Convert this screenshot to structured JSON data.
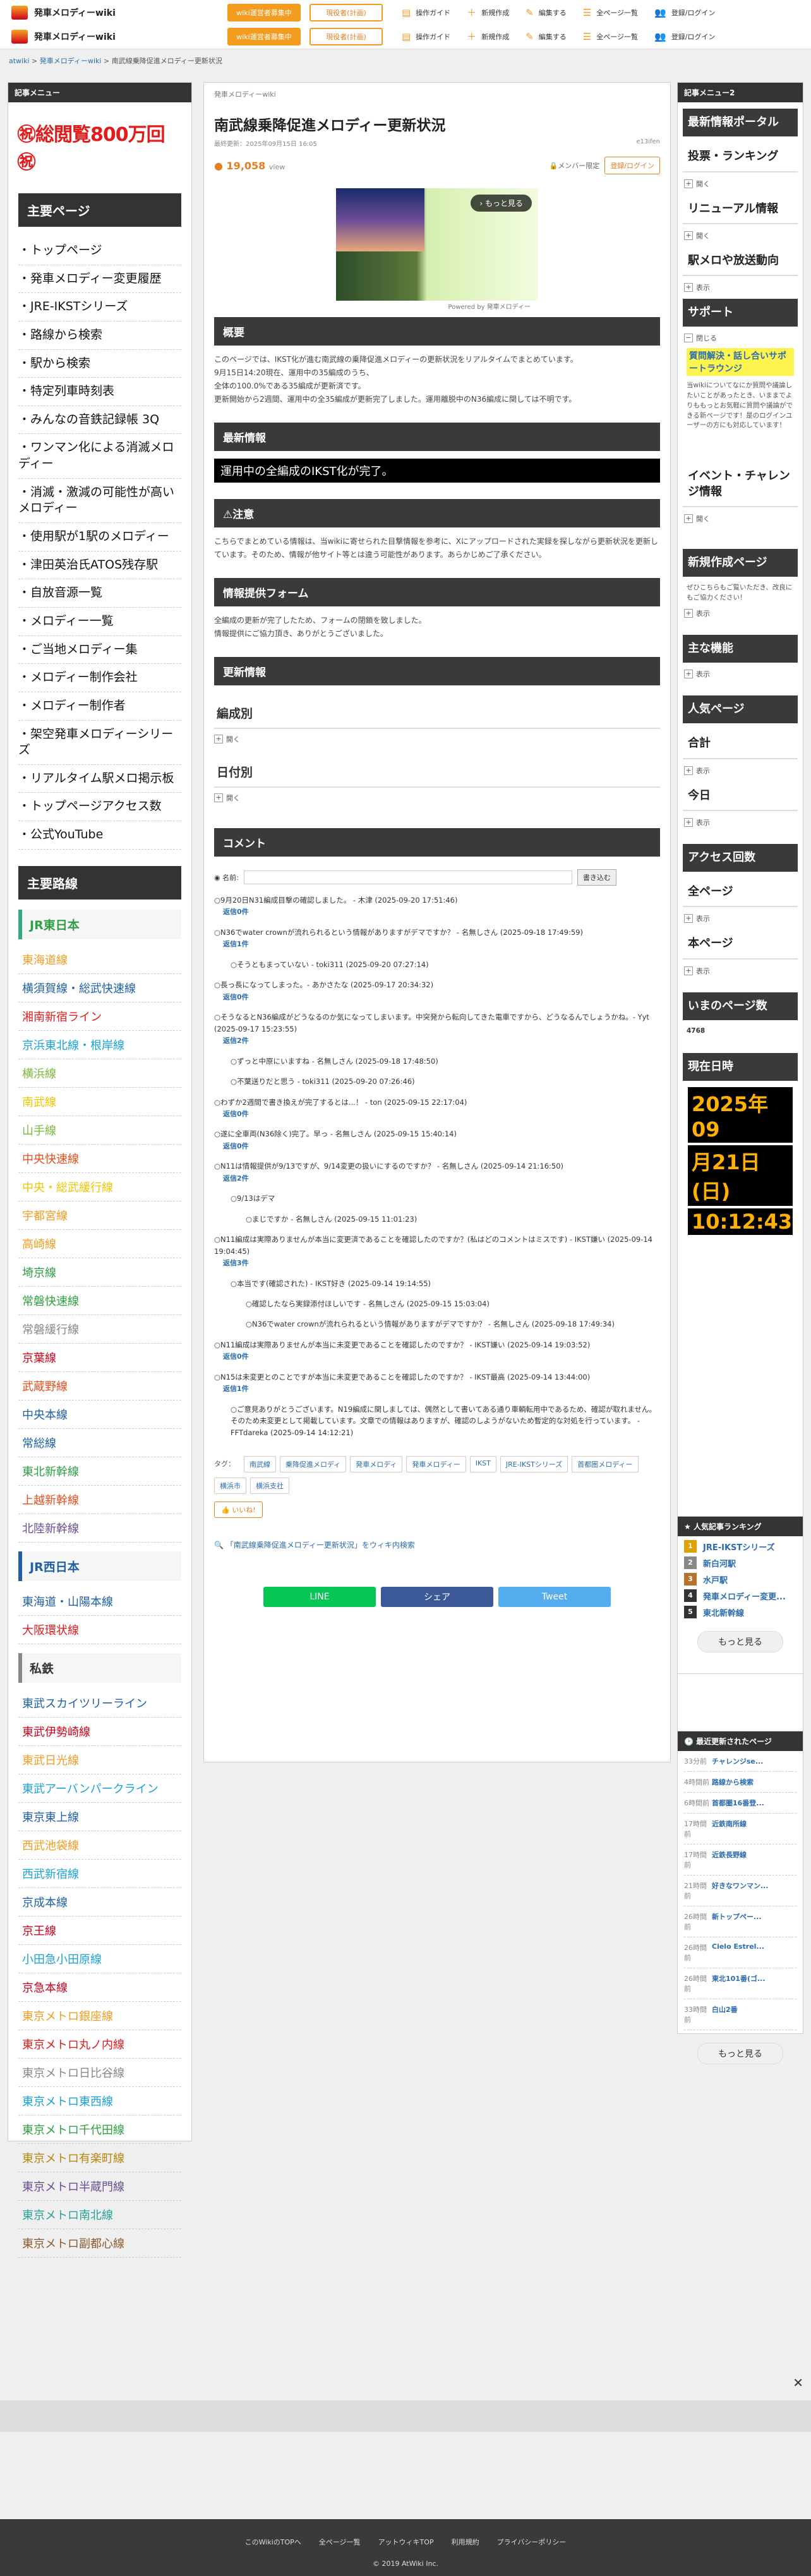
{
  "header": {
    "site_name": "発車メロディーwiki",
    "btn_recruit": "wiki運営者募集中",
    "btn_monitor": "現役者(計画)",
    "menu": [
      "操作ガイド",
      "新規作成",
      "編集する",
      "全ページ一覧",
      "登録/ログイン"
    ]
  },
  "breadcrumb": [
    "atwiki",
    "発車メロディーwiki",
    "南武線乗降促進メロディー更新状況"
  ],
  "left": {
    "menu_title": "記事メニュー",
    "counter": "㊗総閲覧800万回㊗",
    "main_pages_title": "主要ページ",
    "main_pages": [
      "トップページ",
      "発車メロディー変更履歴",
      "JRE-IKSTシリーズ",
      "路線から検索",
      "駅から検索",
      "特定列車時刻表",
      "みんなの音鉄記録帳 3Q",
      "ワンマン化による消滅メロディー",
      "消滅・激減の可能性が高いメロディー",
      "使用駅が1駅のメロディー",
      "津田英治氏ATOS残存駅",
      "自放音源一覧",
      "メロディー一覧",
      "ご当地メロディー集",
      "メロディー制作会社",
      "メロディー制作者",
      "架空発車メロディーシリーズ",
      "リアルタイム駅メロ掲示板",
      "トップページアクセス数",
      "公式YouTube"
    ],
    "routes_title": "主要路線",
    "jre_title": "JR東日本",
    "jre": [
      {
        "n": "東海道線",
        "c": "#f39c1f"
      },
      {
        "n": "横須賀線・総武快速線",
        "c": "#1f5fa8"
      },
      {
        "n": "湘南新宿ライン",
        "c": "#e31b1b"
      },
      {
        "n": "京浜東北線・根岸線",
        "c": "#1aa3d8"
      },
      {
        "n": "横浜線",
        "c": "#7cb83b"
      },
      {
        "n": "南武線",
        "c": "#f3c400"
      },
      {
        "n": "山手線",
        "c": "#7cb83b"
      },
      {
        "n": "中央快速線",
        "c": "#e84e1b"
      },
      {
        "n": "中央・総武緩行線",
        "c": "#f3c400"
      },
      {
        "n": "宇都宮線",
        "c": "#f39c1f"
      },
      {
        "n": "高崎線",
        "c": "#f39c1f"
      },
      {
        "n": "埼京線",
        "c": "#2ea043"
      },
      {
        "n": "常磐快速線",
        "c": "#2ea043"
      },
      {
        "n": "常磐緩行線",
        "c": "#888888"
      },
      {
        "n": "京葉線",
        "c": "#d0021b"
      },
      {
        "n": "武蔵野線",
        "c": "#e84e1b"
      },
      {
        "n": "中央本線",
        "c": "#1f5fa8"
      },
      {
        "n": "常総線",
        "c": "#1f5fa8"
      },
      {
        "n": "東北新幹線",
        "c": "#2ea043"
      },
      {
        "n": "上越新幹線",
        "c": "#e84e1b"
      },
      {
        "n": "北陸新幹線",
        "c": "#6a4c93"
      }
    ],
    "jrw_title": "JR西日本",
    "jrw": [
      {
        "n": "東海道・山陽本線",
        "c": "#1f5fa8"
      },
      {
        "n": "大阪環状線",
        "c": "#e31b1b"
      }
    ],
    "private_title": "私鉄",
    "private": [
      {
        "n": "東武スカイツリーライン",
        "c": "#1f5fa8"
      },
      {
        "n": "東武伊勢崎線",
        "c": "#d0021b"
      },
      {
        "n": "東武日光線",
        "c": "#f39c1f"
      },
      {
        "n": "東武アーバンパークライン",
        "c": "#1aa3d8"
      },
      {
        "n": "東京東上線",
        "c": "#1f5fa8"
      },
      {
        "n": "西武池袋線",
        "c": "#f39c1f"
      },
      {
        "n": "西武新宿線",
        "c": "#1aa3d8"
      },
      {
        "n": "京成本線",
        "c": "#1f5fa8"
      },
      {
        "n": "京王線",
        "c": "#d0021b"
      },
      {
        "n": "小田急小田原線",
        "c": "#1aa3d8"
      },
      {
        "n": "京急本線",
        "c": "#d0021b"
      },
      {
        "n": "東京メトロ銀座線",
        "c": "#f39c1f"
      },
      {
        "n": "東京メトロ丸ノ内線",
        "c": "#e31b1b"
      },
      {
        "n": "東京メトロ日比谷線",
        "c": "#888888"
      },
      {
        "n": "東京メトロ東西線",
        "c": "#1aa3d8"
      },
      {
        "n": "東京メトロ千代田線",
        "c": "#2ea043"
      },
      {
        "n": "東京メトロ有楽町線",
        "c": "#b8860b"
      },
      {
        "n": "東京メトロ半蔵門線",
        "c": "#6a4c93"
      },
      {
        "n": "東京メトロ南北線",
        "c": "#2aa198"
      },
      {
        "n": "東京メトロ副都心線",
        "c": "#8b5a2b"
      }
    ]
  },
  "main": {
    "site": "発車メロディーwiki",
    "title": "南武線乗降促進メロディー更新状況",
    "updated": "最終更新：2025年09月15日 16:05",
    "author": "e13ifen",
    "views": "19,058",
    "views_unit": "view",
    "member": "メンバー限定",
    "login": "登録/ログイン",
    "more_btn": "もっと見る",
    "thumb_cap": "Powered by 発車メロディー",
    "h_overview": "概要",
    "overview": [
      "このページでは、IKST化が進む南武線の乗降促進メロディーの更新状況をリアルタイムでまとめています。",
      "9月15日14:20現在、運用中の35編成のうち、",
      "全体の100.0%である35編成が更新済です。",
      "更新開始から2週間、運用中の全35編成が更新完了しました。運用離脱中のN36編成に関しては不明です。"
    ],
    "h_latest": "最新情報",
    "latest": "運用中の全編成のIKST化が完了。",
    "h_note": "⚠注意",
    "note": "こちらでまとめている情報は、当wikiに寄せられた目撃情報を参考に、Xにアップロードされた実録を探しながら更新状況を更新しています。そのため、情報が他サイト等とは違う可能性があります。あらかじめご了承ください。",
    "h_form": "情報提供フォーム",
    "form": [
      "全編成の更新が完了したため、フォームの閉鎖を致しました。",
      "情報提供にご協力頂き、ありがとうございました。"
    ],
    "h_upd": "更新情報",
    "f1": "編成別",
    "f2": "日付別",
    "open": "開く",
    "h_comment": "コメント",
    "name_label": "名前:",
    "submit": "書き込む",
    "comments": [
      {
        "t": "9月20日N31編成目撃の確認しました。 - 木津 (2025-09-20 17:51:46)",
        "r": "返信0件",
        "d": 0
      },
      {
        "t": "N36でwater crownが流れられるという情報がありますがデマですか？ - 名無しさん (2025-09-18 17:49:59)",
        "r": "返信1件",
        "d": 0
      },
      {
        "t": "そうともまっていない - toki311 (2025-09-20 07:27:14)",
        "r": "",
        "d": 1
      },
      {
        "t": "長っ長になってしまった。- あかさたな (2025-09-17 20:34:32)",
        "r": "返信0件",
        "d": 0
      },
      {
        "t": "そうなるとN36編成がどうなるのか気になってしまいます。中突発から転向してきた電車ですから、どうなるんでしょうかね。- Yyt (2025-09-17 15:23:55)",
        "r": "返信2件",
        "d": 0
      },
      {
        "t": "ずっと中原にいますね - 名無しさん (2025-09-18 17:48:50)",
        "r": "",
        "d": 1
      },
      {
        "t": "不葉送りだと思う - toki311 (2025-09-20 07:26:46)",
        "r": "",
        "d": 1
      },
      {
        "t": "わずか2週間で書き換えが完了するとは...！ - ton (2025-09-15 22:17:04)",
        "r": "返信0件",
        "d": 0
      },
      {
        "t": "遂に全車両(N36除く)完了。早っ - 名無しさん (2025-09-15 15:40:14)",
        "r": "返信0件",
        "d": 0
      },
      {
        "t": "N11は情報提供が9/13ですが、9/14変更の扱いにするのですか？ - 名無しさん (2025-09-14 21:16:50)",
        "r": "返信2件",
        "d": 0
      },
      {
        "t": "9/13はデマ",
        "r": "",
        "d": 1
      },
      {
        "t": "まじですか - 名無しさん (2025-09-15 11:01:23)",
        "r": "",
        "d": 2
      },
      {
        "t": "N11編成は実際ありませんが本当に変更済であることを確認したのですか？(私はどのコメントはミスです) - IKST嫌い (2025-09-14 19:04:45)",
        "r": "返信3件",
        "d": 0
      },
      {
        "t": "本当です(確認された) - IKST好き (2025-09-14 19:14:55)",
        "r": "",
        "d": 1
      },
      {
        "t": "確認したなら実録添付ほしいです - 名無しさん (2025-09-15 15:03:04)",
        "r": "",
        "d": 2
      },
      {
        "t": "N36でwater crownが流れられるという情報がありますがデマですか？ - 名無しさん (2025-09-18 17:49:34)",
        "r": "",
        "d": 2
      },
      {
        "t": "N11編成は実際ありませんが本当に未変更であることを確認したのですか？ - IKST嫌い (2025-09-14 19:03:52)",
        "r": "返信0件",
        "d": 0
      },
      {
        "t": "N15は未変更とのことですが本当に未変更であることを確認したのですか？ - IKST最高 (2025-09-14 13:44:00)",
        "r": "返信1件",
        "d": 0
      },
      {
        "t": "ご意見ありがとうございます。N19編成に関しましては、偶然として書いてある通り車輌転用中であるため、確認が取れません。そのため未変更として掲載しています。文章での情報はありますが、確認のしようがないため暫定的な対処を行っています。 - FFTdareka (2025-09-14 14:12:21)",
        "r": "",
        "d": 1
      }
    ],
    "tags_label": "タグ：",
    "tags": [
      "南武線",
      "乗降促進メロディ",
      "発車メロディ",
      "発車メロディー",
      "IKST",
      "JRE-IKSTシリーズ",
      "首都圏メロディー",
      "横浜市",
      "横浜支社"
    ],
    "nice": "いいね!",
    "wikiprint": "「南武線乗降促進メロディー更新状況」をウィキ内検索",
    "share": [
      {
        "l": "LINE",
        "c": "#06c755"
      },
      {
        "l": "シェア",
        "c": "#3b5998"
      },
      {
        "l": "Tweet",
        "c": "#55acee"
      }
    ]
  },
  "right": {
    "menu2": "記事メニュー2",
    "p1": "最新情報ポータル",
    "p2": "投票・ランキング",
    "p3": "リニューアル情報",
    "p4": "駅メロや放送動向",
    "show": "表示",
    "open": "開く",
    "close": "閉じる",
    "support": "サポート",
    "support_title": "質問解決・話し合いサポートラウンジ",
    "support_text": "当wikiについてなにか質問や議論したいことがあったとき、いままでよりももっとお気軽に質問や議論ができる新ページです！是のログインユーザーの方にも対応しています！",
    "event": "イベント・チャレンジ情報",
    "newpage": "新規作成ページ",
    "newpage_text": "ぜひこちらもご覧いただき、改良にもご協力ください！",
    "mainfunc": "主な機能",
    "popular": "人気ページ",
    "total": "合計",
    "today": "今日",
    "access": "アクセス回数",
    "allpages": "全ページ",
    "thispage": "本ページ",
    "now_views": "いまのページ数",
    "now_views_val": "4768",
    "time_title": "現在日時",
    "date1": "2025年09",
    "date2": "月21日 (日)",
    "time": "10:12:43",
    "ranking_title": "人気記事ランキング",
    "ranking": [
      {
        "n": "1",
        "t": "JRE-IKSTシリーズ",
        "c": "#e0a000"
      },
      {
        "n": "2",
        "t": "新白河駅",
        "c": "#888"
      },
      {
        "n": "3",
        "t": "水戸駅",
        "c": "#b8732b"
      },
      {
        "n": "4",
        "t": "発車メロディー変更...",
        "c": "#333"
      },
      {
        "n": "5",
        "t": "東北新幹線",
        "c": "#333"
      }
    ],
    "more": "もっと見る",
    "recent_title": "最近更新されたページ",
    "recent": [
      {
        "d": "33分前",
        "t": "チャレンジse..."
      },
      {
        "d": "4時間前",
        "t": "路線から検索"
      },
      {
        "d": "6時間前",
        "t": "首都圏16番登..."
      },
      {
        "d": "17時間前",
        "t": "近鉄南所線"
      },
      {
        "d": "17時間前",
        "t": "近鉄長野線"
      },
      {
        "d": "21時間前",
        "t": "好きなワンマン..."
      },
      {
        "d": "26時間前",
        "t": "新トップペー..."
      },
      {
        "d": "26時間前",
        "t": "Cielo Estrel..."
      },
      {
        "d": "26時間前",
        "t": "東北101番(ゴ..."
      },
      {
        "d": "33時間前",
        "t": "白山2番"
      }
    ]
  },
  "footer": {
    "links": [
      "このWikiのTOPへ",
      "全ページ一覧",
      "アットウィキTOP",
      "利用規約",
      "プライバシーポリシー"
    ],
    "copyright": "2019 AtWiki Inc."
  }
}
